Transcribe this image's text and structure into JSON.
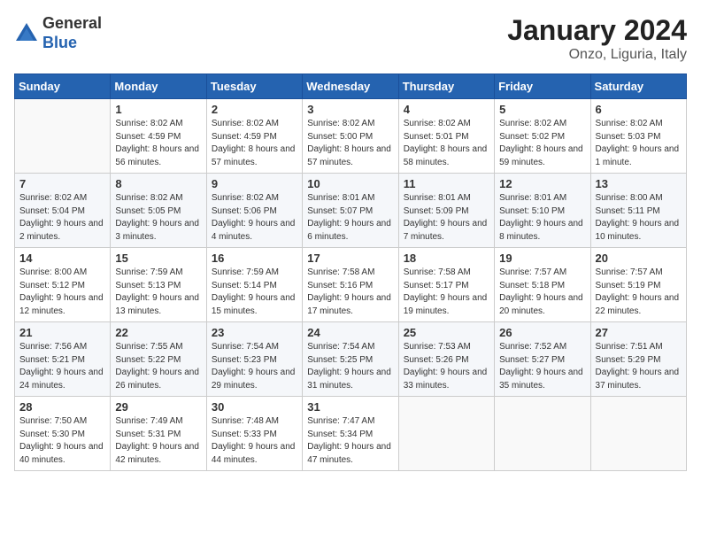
{
  "header": {
    "logo_general": "General",
    "logo_blue": "Blue",
    "month_title": "January 2024",
    "subtitle": "Onzo, Liguria, Italy"
  },
  "weekdays": [
    "Sunday",
    "Monday",
    "Tuesday",
    "Wednesday",
    "Thursday",
    "Friday",
    "Saturday"
  ],
  "weeks": [
    [
      {
        "day": "",
        "sunrise": "",
        "sunset": "",
        "daylight": ""
      },
      {
        "day": "1",
        "sunrise": "Sunrise: 8:02 AM",
        "sunset": "Sunset: 4:59 PM",
        "daylight": "Daylight: 8 hours and 56 minutes."
      },
      {
        "day": "2",
        "sunrise": "Sunrise: 8:02 AM",
        "sunset": "Sunset: 4:59 PM",
        "daylight": "Daylight: 8 hours and 57 minutes."
      },
      {
        "day": "3",
        "sunrise": "Sunrise: 8:02 AM",
        "sunset": "Sunset: 5:00 PM",
        "daylight": "Daylight: 8 hours and 57 minutes."
      },
      {
        "day": "4",
        "sunrise": "Sunrise: 8:02 AM",
        "sunset": "Sunset: 5:01 PM",
        "daylight": "Daylight: 8 hours and 58 minutes."
      },
      {
        "day": "5",
        "sunrise": "Sunrise: 8:02 AM",
        "sunset": "Sunset: 5:02 PM",
        "daylight": "Daylight: 8 hours and 59 minutes."
      },
      {
        "day": "6",
        "sunrise": "Sunrise: 8:02 AM",
        "sunset": "Sunset: 5:03 PM",
        "daylight": "Daylight: 9 hours and 1 minute."
      }
    ],
    [
      {
        "day": "7",
        "sunrise": "Sunrise: 8:02 AM",
        "sunset": "Sunset: 5:04 PM",
        "daylight": "Daylight: 9 hours and 2 minutes."
      },
      {
        "day": "8",
        "sunrise": "Sunrise: 8:02 AM",
        "sunset": "Sunset: 5:05 PM",
        "daylight": "Daylight: 9 hours and 3 minutes."
      },
      {
        "day": "9",
        "sunrise": "Sunrise: 8:02 AM",
        "sunset": "Sunset: 5:06 PM",
        "daylight": "Daylight: 9 hours and 4 minutes."
      },
      {
        "day": "10",
        "sunrise": "Sunrise: 8:01 AM",
        "sunset": "Sunset: 5:07 PM",
        "daylight": "Daylight: 9 hours and 6 minutes."
      },
      {
        "day": "11",
        "sunrise": "Sunrise: 8:01 AM",
        "sunset": "Sunset: 5:09 PM",
        "daylight": "Daylight: 9 hours and 7 minutes."
      },
      {
        "day": "12",
        "sunrise": "Sunrise: 8:01 AM",
        "sunset": "Sunset: 5:10 PM",
        "daylight": "Daylight: 9 hours and 8 minutes."
      },
      {
        "day": "13",
        "sunrise": "Sunrise: 8:00 AM",
        "sunset": "Sunset: 5:11 PM",
        "daylight": "Daylight: 9 hours and 10 minutes."
      }
    ],
    [
      {
        "day": "14",
        "sunrise": "Sunrise: 8:00 AM",
        "sunset": "Sunset: 5:12 PM",
        "daylight": "Daylight: 9 hours and 12 minutes."
      },
      {
        "day": "15",
        "sunrise": "Sunrise: 7:59 AM",
        "sunset": "Sunset: 5:13 PM",
        "daylight": "Daylight: 9 hours and 13 minutes."
      },
      {
        "day": "16",
        "sunrise": "Sunrise: 7:59 AM",
        "sunset": "Sunset: 5:14 PM",
        "daylight": "Daylight: 9 hours and 15 minutes."
      },
      {
        "day": "17",
        "sunrise": "Sunrise: 7:58 AM",
        "sunset": "Sunset: 5:16 PM",
        "daylight": "Daylight: 9 hours and 17 minutes."
      },
      {
        "day": "18",
        "sunrise": "Sunrise: 7:58 AM",
        "sunset": "Sunset: 5:17 PM",
        "daylight": "Daylight: 9 hours and 19 minutes."
      },
      {
        "day": "19",
        "sunrise": "Sunrise: 7:57 AM",
        "sunset": "Sunset: 5:18 PM",
        "daylight": "Daylight: 9 hours and 20 minutes."
      },
      {
        "day": "20",
        "sunrise": "Sunrise: 7:57 AM",
        "sunset": "Sunset: 5:19 PM",
        "daylight": "Daylight: 9 hours and 22 minutes."
      }
    ],
    [
      {
        "day": "21",
        "sunrise": "Sunrise: 7:56 AM",
        "sunset": "Sunset: 5:21 PM",
        "daylight": "Daylight: 9 hours and 24 minutes."
      },
      {
        "day": "22",
        "sunrise": "Sunrise: 7:55 AM",
        "sunset": "Sunset: 5:22 PM",
        "daylight": "Daylight: 9 hours and 26 minutes."
      },
      {
        "day": "23",
        "sunrise": "Sunrise: 7:54 AM",
        "sunset": "Sunset: 5:23 PM",
        "daylight": "Daylight: 9 hours and 29 minutes."
      },
      {
        "day": "24",
        "sunrise": "Sunrise: 7:54 AM",
        "sunset": "Sunset: 5:25 PM",
        "daylight": "Daylight: 9 hours and 31 minutes."
      },
      {
        "day": "25",
        "sunrise": "Sunrise: 7:53 AM",
        "sunset": "Sunset: 5:26 PM",
        "daylight": "Daylight: 9 hours and 33 minutes."
      },
      {
        "day": "26",
        "sunrise": "Sunrise: 7:52 AM",
        "sunset": "Sunset: 5:27 PM",
        "daylight": "Daylight: 9 hours and 35 minutes."
      },
      {
        "day": "27",
        "sunrise": "Sunrise: 7:51 AM",
        "sunset": "Sunset: 5:29 PM",
        "daylight": "Daylight: 9 hours and 37 minutes."
      }
    ],
    [
      {
        "day": "28",
        "sunrise": "Sunrise: 7:50 AM",
        "sunset": "Sunset: 5:30 PM",
        "daylight": "Daylight: 9 hours and 40 minutes."
      },
      {
        "day": "29",
        "sunrise": "Sunrise: 7:49 AM",
        "sunset": "Sunset: 5:31 PM",
        "daylight": "Daylight: 9 hours and 42 minutes."
      },
      {
        "day": "30",
        "sunrise": "Sunrise: 7:48 AM",
        "sunset": "Sunset: 5:33 PM",
        "daylight": "Daylight: 9 hours and 44 minutes."
      },
      {
        "day": "31",
        "sunrise": "Sunrise: 7:47 AM",
        "sunset": "Sunset: 5:34 PM",
        "daylight": "Daylight: 9 hours and 47 minutes."
      },
      {
        "day": "",
        "sunrise": "",
        "sunset": "",
        "daylight": ""
      },
      {
        "day": "",
        "sunrise": "",
        "sunset": "",
        "daylight": ""
      },
      {
        "day": "",
        "sunrise": "",
        "sunset": "",
        "daylight": ""
      }
    ]
  ]
}
